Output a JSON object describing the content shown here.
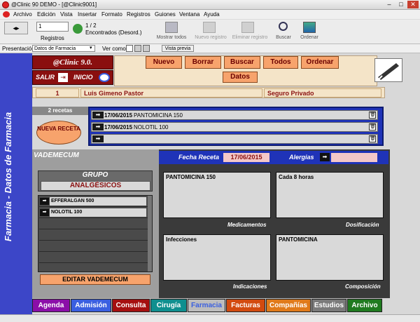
{
  "window": {
    "title": "@Clinic 90 DEMO - [@Clinic9001]"
  },
  "menu": [
    "Archivo",
    "Edición",
    "Vista",
    "Insertar",
    "Formato",
    "Registros",
    "Guiones",
    "Ventana",
    "Ayuda"
  ],
  "toolbar": {
    "record_value": "1",
    "records_label": "Registros",
    "found_count": "1 / 2",
    "found_label": "Encontrados (Desord.)",
    "show_all": "Mostrar todos",
    "new_record": "Nuevo registro",
    "delete_record": "Eliminar registro",
    "search": "Buscar",
    "sort": "Ordenar"
  },
  "toolbar2": {
    "presentation_label": "Presentación:",
    "presentation_value": "Datos de Farmacia",
    "view_as_label": "Ver como:",
    "preview": "Vista previa"
  },
  "side_title": "Farmacia - Datos de Farmacia",
  "logo": "@Clinic 9.0.",
  "nav": {
    "exit": "SALIR",
    "home": "INICIO"
  },
  "actions": {
    "new": "Nuevo",
    "delete": "Borrar",
    "search": "Buscar",
    "all": "Todos",
    "sort": "Ordenar"
  },
  "datos_label": "Datos",
  "patient": {
    "id": "1",
    "name": "Luis Gimeno Pastor",
    "insurance": "Seguro Privado"
  },
  "recetas_count": "2 recetas",
  "new_receta": "NUEVA RECETA",
  "recetas": [
    {
      "date": "17/06/2015",
      "name": "PANTOMICINA 150"
    },
    {
      "date": "17/06/2015",
      "name": "NOLOTIL 100"
    },
    {
      "date": "",
      "name": ""
    }
  ],
  "vademecum": {
    "title": "VADEMECUM",
    "group_label": "GRUPO",
    "group_value": "ANALGÉSICOS",
    "drugs": [
      "EFFERALGAN 500",
      "NOLOTIL 100"
    ],
    "edit_button": "EDITAR VADEMECUM"
  },
  "details": {
    "fecha_label": "Fecha Receta",
    "fecha_value": "17/06/2015",
    "alergias_label": "Alergias",
    "alergias_value": "",
    "medicamentos": "PANTOMICINA 150",
    "medicamentos_label": "Medicamentos",
    "dosificacion": "Cada 8 horas",
    "dosificacion_label": "Dosificación",
    "indicaciones": "Infecciones",
    "indicaciones_label": "Indicaciones",
    "composicion": "PANTOMICINA",
    "composicion_label": "Composición"
  },
  "tabs": [
    {
      "label": "Agenda",
      "color": "#8b0ea8",
      "text": "#ffffff"
    },
    {
      "label": "Admisión",
      "color": "#3a5fe0",
      "text": "#ffffff"
    },
    {
      "label": "Consulta",
      "color": "#a50f0f",
      "text": "#ffffff"
    },
    {
      "label": "Cirugía",
      "color": "#0f8f8f",
      "text": "#ffffff"
    },
    {
      "label": "Farmacia",
      "color": "#bdbdbd",
      "text": "#3a5fe0"
    },
    {
      "label": "Facturas",
      "color": "#d24a0f",
      "text": "#ffffff"
    },
    {
      "label": "Compañías",
      "color": "#e07a1a",
      "text": "#ffffff"
    },
    {
      "label": "Estudios",
      "color": "#7a7a7a",
      "text": "#ffffff"
    },
    {
      "label": "Archivo",
      "color": "#1f7a1f",
      "text": "#ffffff"
    }
  ]
}
